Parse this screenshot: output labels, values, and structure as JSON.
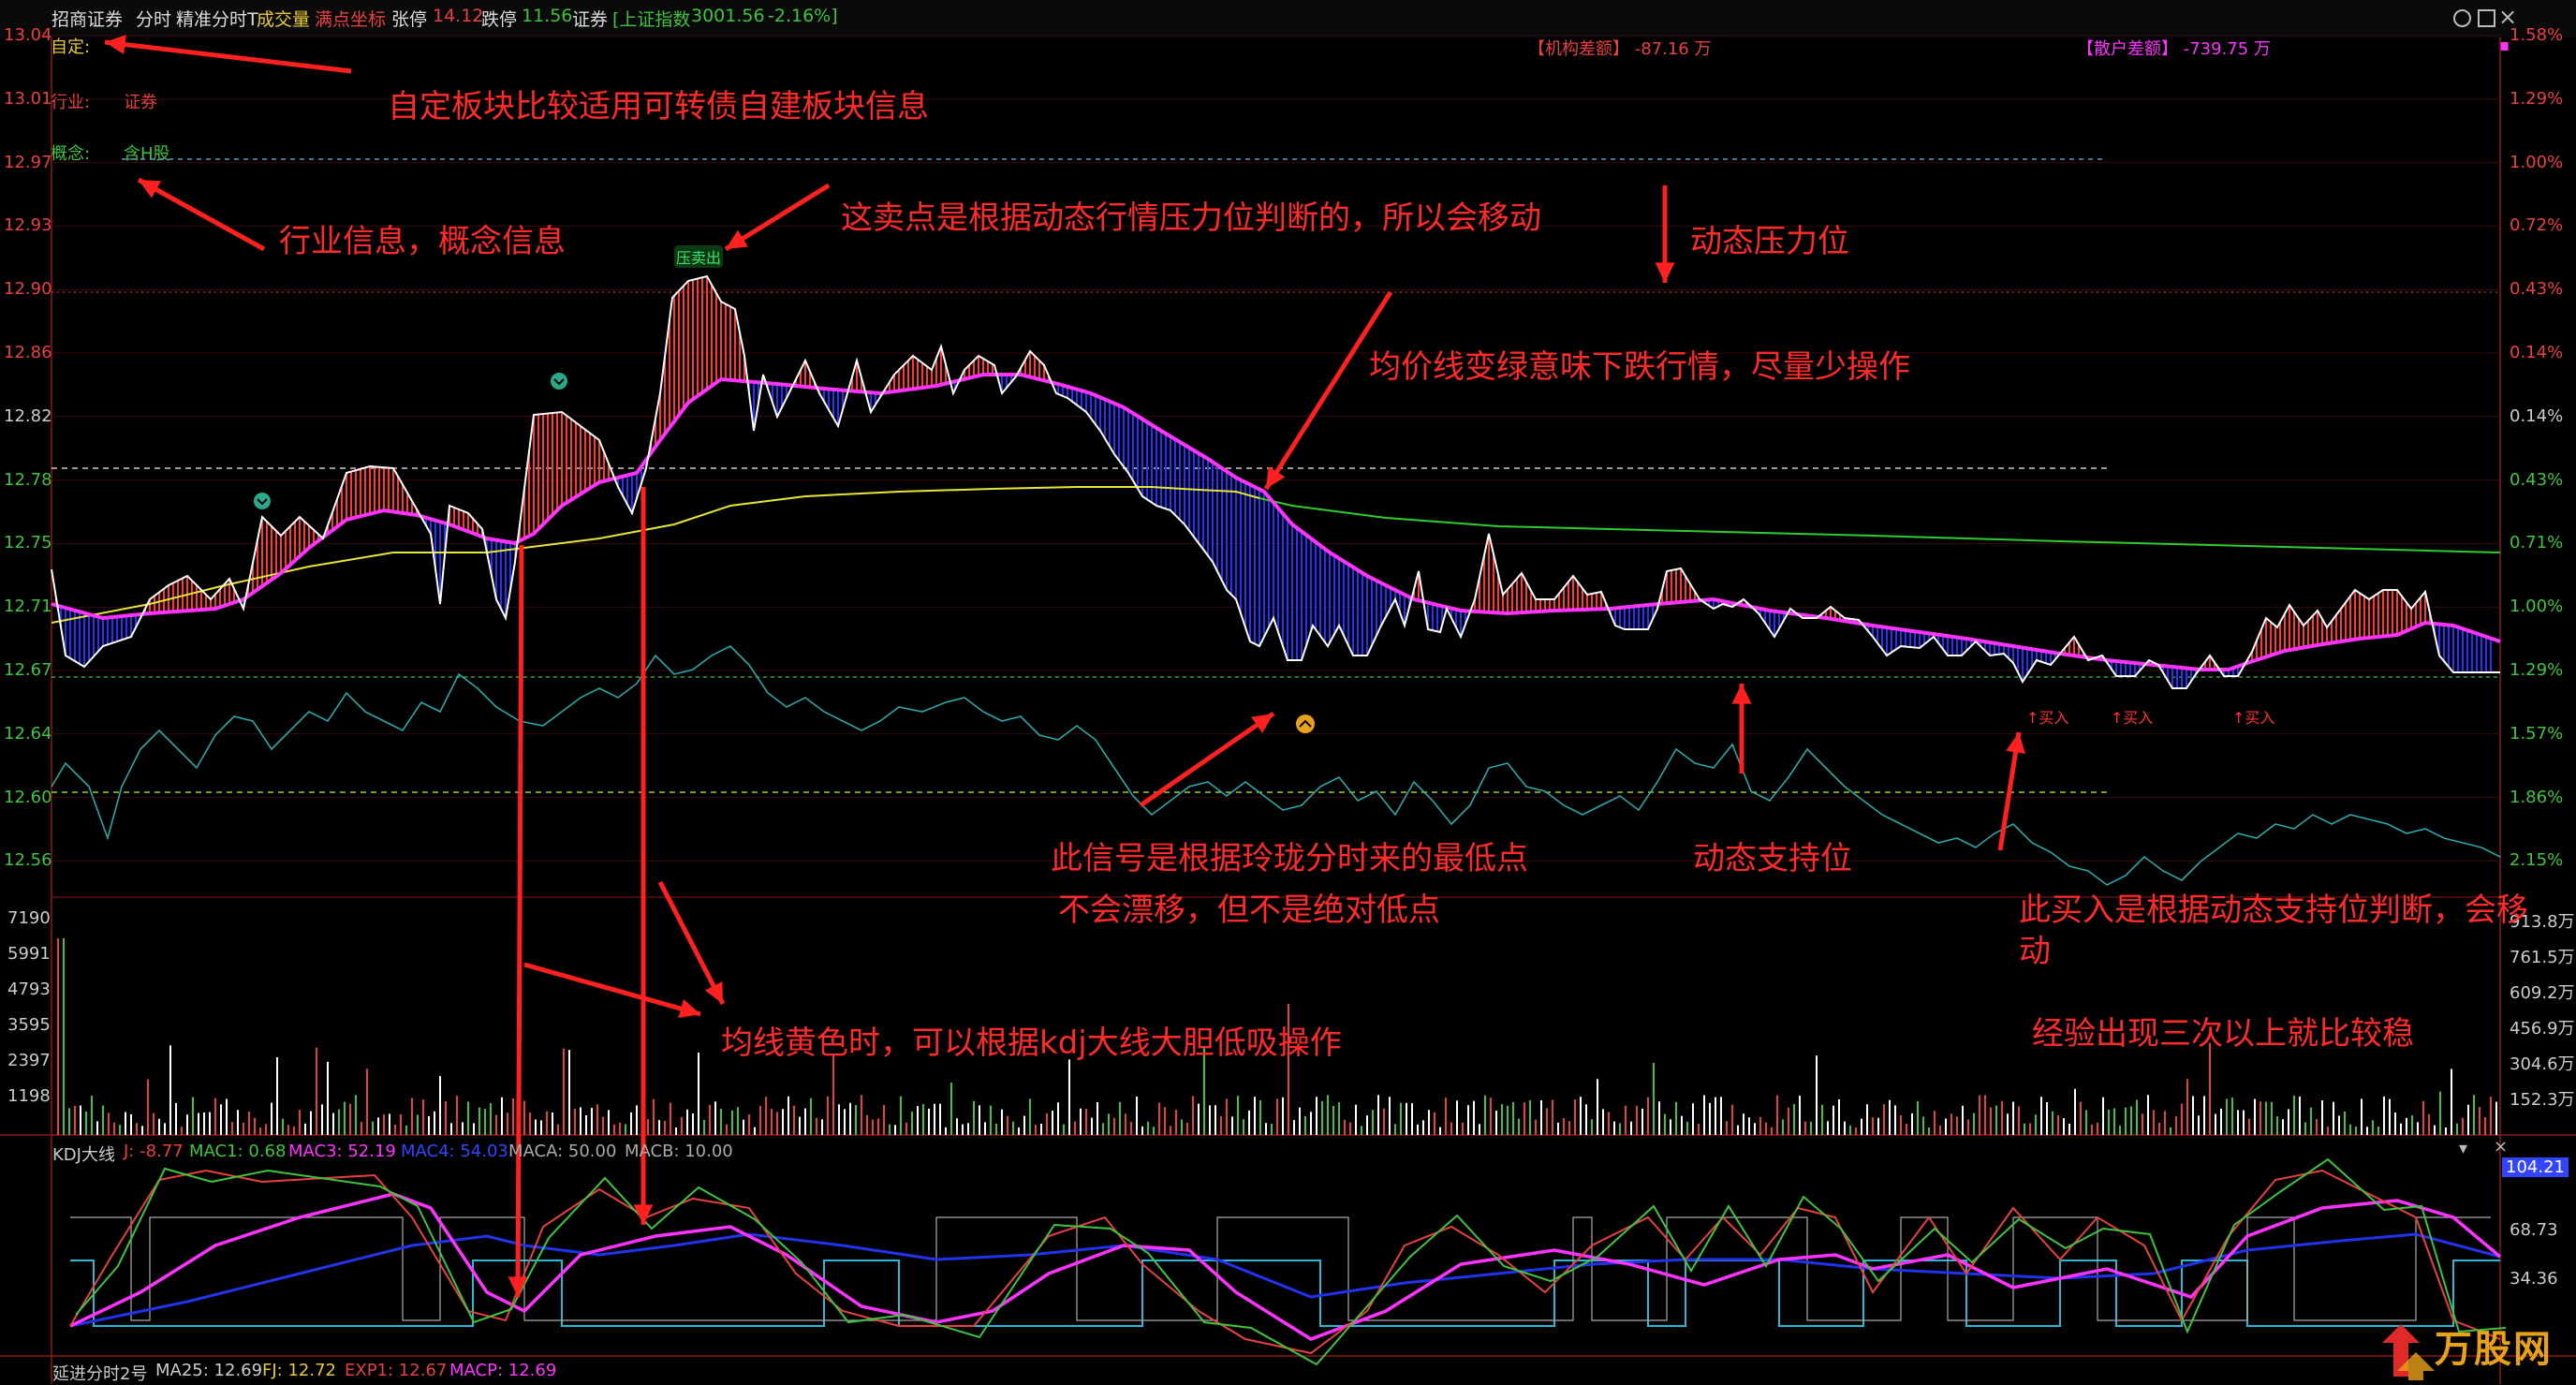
{
  "topbar": {
    "stock": "招商证券",
    "mode": "分时",
    "precise": "精准分时T",
    "volume": "成交量",
    "coord": "满点坐标",
    "limit_up_label": "张停",
    "limit_up_value": "14.12",
    "limit_down_label": "跌停",
    "limit_down_value": "11.56",
    "sector": "证券",
    "index_bracket": "[上证指数",
    "index_value": "3001.56",
    "index_change": "-2.16%]"
  },
  "left_panel": {
    "custom_label": "自定:",
    "industry_label": "行业:",
    "industry_value": "证券",
    "concept_label": "概念:",
    "concept_value": "含H股"
  },
  "flows": {
    "institution": "【机构差额】 -87.16 万",
    "retail": "【散户差额】 -739.75 万"
  },
  "signals": {
    "sell": "压卖出",
    "buy": "买入"
  },
  "price_axis": [
    "13.04",
    "13.01",
    "12.97",
    "12.93",
    "12.90",
    "12.86",
    "12.82",
    "12.78",
    "12.75",
    "12.71",
    "12.67",
    "12.64",
    "12.60",
    "12.56"
  ],
  "pct_axis": [
    "1.58%",
    "1.29%",
    "1.00%",
    "0.72%",
    "0.43%",
    "0.14%",
    "0.14%",
    "0.43%",
    "0.71%",
    "1.00%",
    "1.29%",
    "1.57%",
    "1.86%",
    "2.15%"
  ],
  "volume_axis_left": [
    "7190",
    "5991",
    "4793",
    "3595",
    "2397",
    "1198"
  ],
  "volume_axis_right": [
    "913.8万",
    "761.5万",
    "609.2万",
    "456.9万",
    "304.6万",
    "152.3万"
  ],
  "kdj": {
    "name": "KDJ大线",
    "j": "J: -8.77",
    "mac1": "MAC1: 0.68",
    "mac3": "MAC3: 52.19",
    "mac4": "MAC4: 54.03",
    "maca": "MACA: 50.00",
    "macb": "MACB: 10.00",
    "axis": [
      "104.21",
      "68.73",
      "34.36"
    ]
  },
  "bottom": {
    "name": "延进分时2号",
    "ma25": "MA25: 12.69",
    "fj": "FJ: 12.72",
    "exp1": "EXP1: 12.67",
    "macp": "MACP: 12.69"
  },
  "annotations": {
    "a1": "自定板块比较适用可转债自建板块信息",
    "a2": "行业信息，概念信息",
    "a3": "这卖点是根据动态行情压力位判断的，所以会移动",
    "a4": "动态压力位",
    "a5": "均价线变绿意味下跌行情，尽量少操作",
    "a6": "此信号是根据玲珑分时来的最低点",
    "a7": "不会漂移，但不是绝对低点",
    "a8": "动态支持位",
    "a9": "此买入是根据动态支持位判断，会移",
    "a9b": "动",
    "a10": "均线黄色时，可以根据kdj大线大胆低吸操作",
    "a11": "经验出现三次以上就比较稳"
  },
  "watermark": "万股网",
  "colors": {
    "up": "#ff3b2f",
    "down": "#2233ff",
    "avg_up": "#e6e63a",
    "avg_down": "#2ecc2e",
    "ma": "#ff33ff",
    "cyan": "#2aa7a7",
    "annotation": "#ff2a2a"
  }
}
